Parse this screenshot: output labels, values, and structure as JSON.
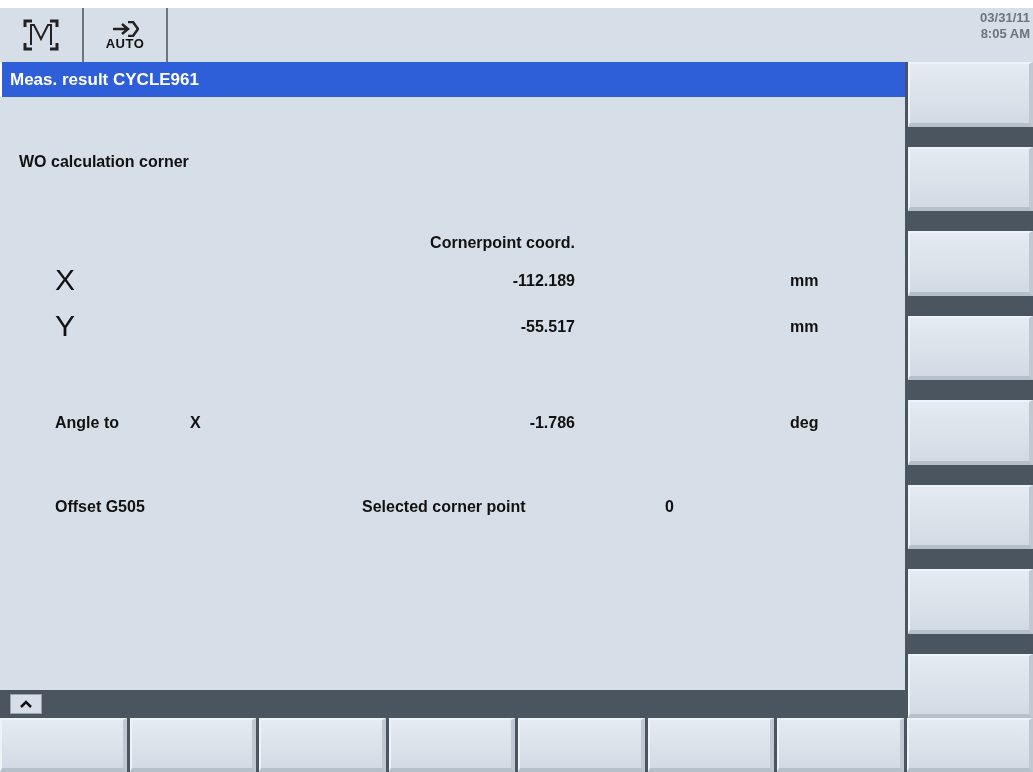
{
  "header": {
    "mode_label": "AUTO",
    "date": "03/31/11",
    "time": "8:05 AM"
  },
  "title": "Meas. result CYCLE961",
  "heading": "WO calculation corner",
  "column_header": "Cornerpoint coord.",
  "rows": [
    {
      "kind": "axis",
      "axis": "X",
      "value": "-112.189",
      "unit": "mm"
    },
    {
      "kind": "axis",
      "axis": "Y",
      "value": "-55.517",
      "unit": "mm"
    },
    {
      "kind": "angle",
      "label": "Angle to",
      "axis": "X",
      "value": "-1.786",
      "unit": "deg"
    },
    {
      "kind": "selection",
      "label": "Offset G505",
      "caption": "Selected corner point",
      "value": "0"
    }
  ]
}
